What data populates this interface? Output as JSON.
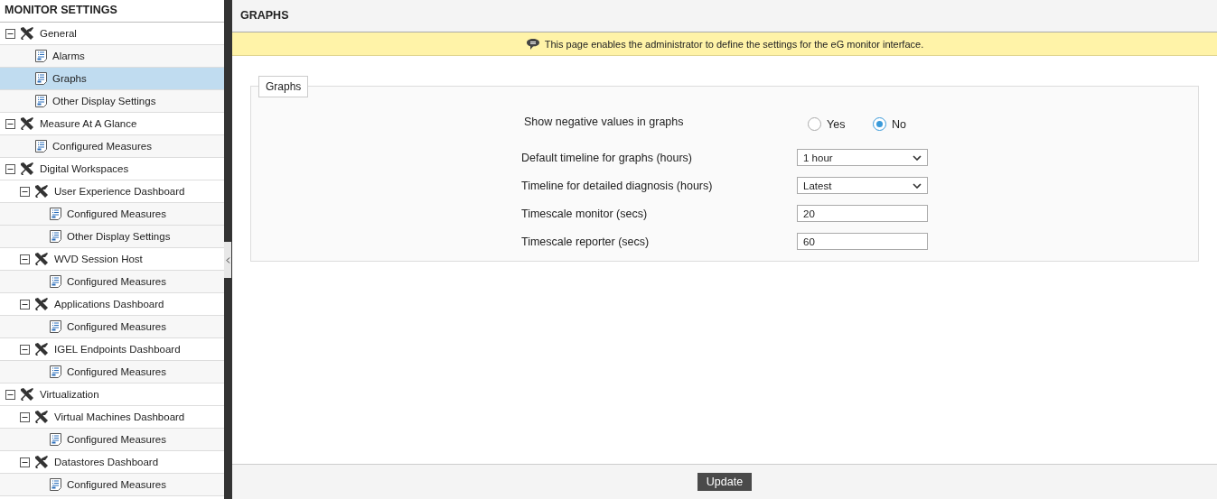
{
  "sidebar": {
    "title": "MONITOR SETTINGS",
    "tree": [
      {
        "kind": "group",
        "label": "General",
        "expanded": true,
        "children": [
          {
            "kind": "leaf",
            "label": "Alarms",
            "selected": false
          },
          {
            "kind": "leaf",
            "label": "Graphs",
            "selected": true
          },
          {
            "kind": "leaf",
            "label": "Other Display Settings",
            "selected": false
          }
        ]
      },
      {
        "kind": "group",
        "label": "Measure At A Glance",
        "expanded": true,
        "children": [
          {
            "kind": "leaf",
            "label": "Configured Measures",
            "selected": false
          }
        ]
      },
      {
        "kind": "group",
        "label": "Digital Workspaces",
        "expanded": true,
        "children": [
          {
            "kind": "group",
            "label": "User Experience Dashboard",
            "expanded": true,
            "children": [
              {
                "kind": "leaf",
                "label": "Configured Measures",
                "selected": false
              },
              {
                "kind": "leaf",
                "label": "Other Display Settings",
                "selected": false
              }
            ]
          },
          {
            "kind": "group",
            "label": "WVD Session Host",
            "expanded": true,
            "children": [
              {
                "kind": "leaf",
                "label": "Configured Measures",
                "selected": false
              }
            ]
          },
          {
            "kind": "group",
            "label": "Applications Dashboard",
            "expanded": true,
            "children": [
              {
                "kind": "leaf",
                "label": "Configured Measures",
                "selected": false
              }
            ]
          },
          {
            "kind": "group",
            "label": "IGEL Endpoints Dashboard",
            "expanded": true,
            "children": [
              {
                "kind": "leaf",
                "label": "Configured Measures",
                "selected": false
              }
            ]
          }
        ]
      },
      {
        "kind": "group",
        "label": "Virtualization",
        "expanded": true,
        "children": [
          {
            "kind": "group",
            "label": "Virtual Machines Dashboard",
            "expanded": true,
            "children": [
              {
                "kind": "leaf",
                "label": "Configured Measures",
                "selected": false
              }
            ]
          },
          {
            "kind": "group",
            "label": "Datastores Dashboard",
            "expanded": true,
            "children": [
              {
                "kind": "leaf",
                "label": "Configured Measures",
                "selected": false
              }
            ]
          }
        ]
      }
    ]
  },
  "page": {
    "title": "GRAPHS",
    "notice": "This page enables the administrator to define the settings for the eG monitor interface.",
    "section": {
      "legend": "Graphs",
      "fields": [
        {
          "kind": "radio",
          "label": "Show negative values in graphs",
          "options": [
            {
              "label": "Yes",
              "selected": false
            },
            {
              "label": "No",
              "selected": true
            }
          ]
        },
        {
          "kind": "select",
          "label": "Default timeline for graphs (hours)",
          "value": "1 hour"
        },
        {
          "kind": "select",
          "label": "Timeline for detailed diagnosis (hours)",
          "value": "Latest"
        },
        {
          "kind": "text",
          "label": "Timescale monitor (secs)",
          "value": "20"
        },
        {
          "kind": "text",
          "label": "Timescale reporter (secs)",
          "value": "60"
        }
      ]
    },
    "button": "Update"
  }
}
